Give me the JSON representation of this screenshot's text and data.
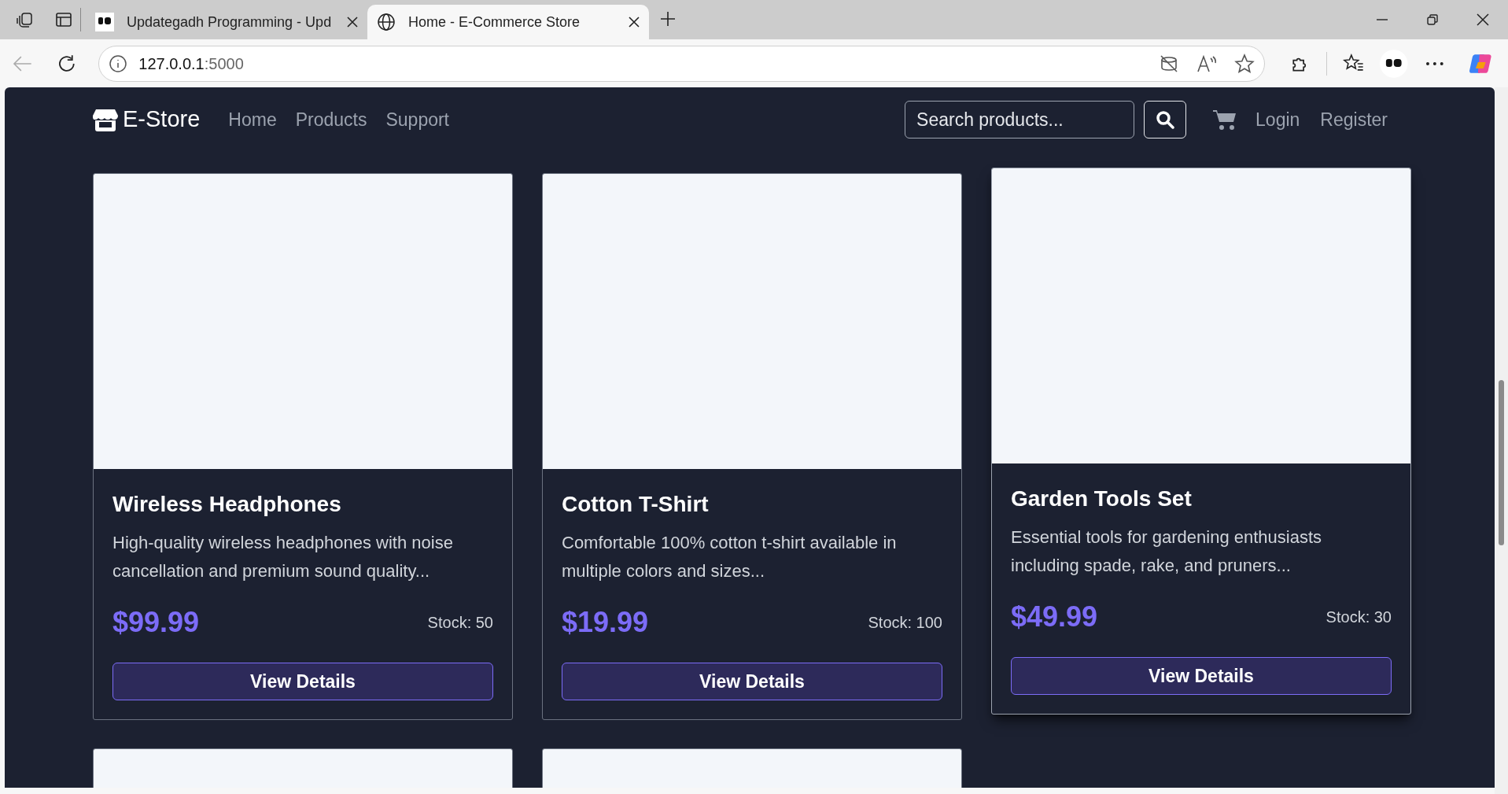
{
  "browser": {
    "tabs": [
      {
        "title": "Updategadh Programming - Upd",
        "selected": false,
        "kind": "ug"
      },
      {
        "title": "Home - E-Commerce Store",
        "selected": true,
        "kind": "globe"
      }
    ],
    "address": {
      "host": "127.0.0.1",
      "port": ":5000"
    }
  },
  "navbar": {
    "brand": "E-Store",
    "links": [
      "Home",
      "Products",
      "Support"
    ],
    "search": {
      "placeholder": "Search products..."
    },
    "auth_links": [
      "Login",
      "Register"
    ]
  },
  "products": [
    {
      "name": "Wireless Headphones",
      "description": "High-quality wireless headphones with noise cancellation and premium sound quality...",
      "price": "$99.99",
      "stock": "Stock: 50",
      "button": "View Details",
      "hovered": false
    },
    {
      "name": "Cotton T-Shirt",
      "description": "Comfortable 100% cotton t-shirt available in multiple colors and sizes...",
      "price": "$19.99",
      "stock": "Stock: 100",
      "button": "View Details",
      "hovered": false
    },
    {
      "name": "Garden Tools Set",
      "description": "Essential tools for gardening enthusiasts including spade, rake, and pruners...",
      "price": "$49.99",
      "stock": "Stock: 30",
      "button": "View Details",
      "hovered": true
    },
    {
      "hovered": false
    },
    {
      "hovered": false
    }
  ]
}
